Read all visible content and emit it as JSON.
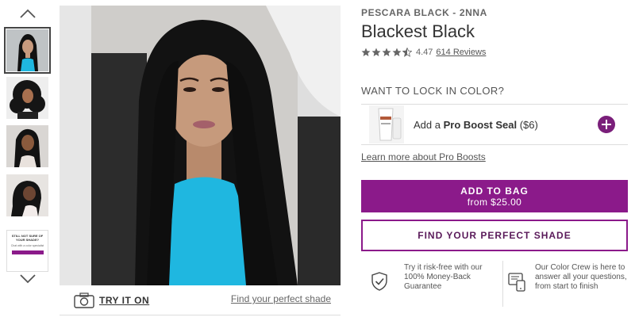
{
  "rail": {
    "up_icon": "chevron-up-icon",
    "down_icon": "chevron-down-icon",
    "thumbnails": [
      {
        "kind": "photo",
        "active": true
      },
      {
        "kind": "photo",
        "active": false
      },
      {
        "kind": "photo",
        "active": false
      },
      {
        "kind": "photo",
        "active": false
      },
      {
        "kind": "card",
        "active": false
      }
    ]
  },
  "try_on": {
    "label": "TRY IT ON",
    "icon": "camera-icon",
    "find_link": "Find your perfect shade"
  },
  "product": {
    "brand_line": "PESCARA BLACK - 2NNA",
    "title": "Blackest Black",
    "rating": 4.47,
    "rating_text": "4.47",
    "reviews_text": "614 Reviews",
    "stars_max": 5
  },
  "lock": {
    "heading": "WANT TO LOCK IN COLOR?",
    "addon_prefix": "Add a",
    "addon_name": "Pro Boost Seal",
    "addon_price": "($6)",
    "learn_more": "Learn more about Pro Boosts"
  },
  "cart": {
    "add_label": "ADD TO BAG",
    "price_line": "from $25.00",
    "find_shade_label": "FIND YOUR PERFECT SHADE"
  },
  "promises": {
    "left": "Try it risk-free with our 100% Money-Back Guarantee",
    "right": "Our Color Crew is here to answer all your questions, from start to finish"
  },
  "colors": {
    "accent": "#8b1a8a",
    "hair": "#141414",
    "top": "#1fb7e0"
  }
}
